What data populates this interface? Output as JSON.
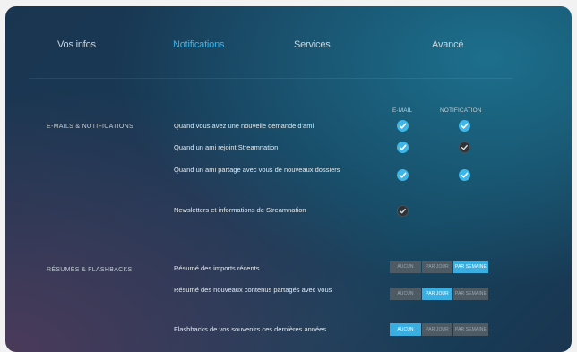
{
  "tabs": [
    {
      "label": "Vos infos",
      "active": false
    },
    {
      "label": "Notifications",
      "active": true
    },
    {
      "label": "Services",
      "active": false
    },
    {
      "label": "Avancé",
      "active": false
    }
  ],
  "emails": {
    "section_title": "E-MAILS & NOTIFICATIONS",
    "columns": [
      "E-MAIL",
      "NOTIFICATION"
    ],
    "rows": [
      {
        "label": "Quand vous avez une nouvelle demande d'ami",
        "email": true,
        "notification": true
      },
      {
        "label": "Quand un ami rejoint Streamnation",
        "email": true,
        "notification": false
      },
      {
        "label": "Quand un ami partage avec vous de nouveaux dossiers",
        "email": true,
        "notification": true
      },
      {
        "label": "Newsletters et informations de Streamnation",
        "email": false,
        "notification": null
      }
    ]
  },
  "summaries": {
    "section_title": "RÉSUMÉS & FLASHBACKS",
    "options": [
      "AUCUN",
      "PAR JOUR",
      "PAR SEMAINE"
    ],
    "rows": [
      {
        "label": "Résumé des imports récents",
        "selected": "PAR SEMAINE"
      },
      {
        "label": "Résumé des nouveaux contenus partagés avec vous",
        "selected": "PAR JOUR"
      },
      {
        "label": "Flashbacks de vos souvenirs ces dernières années",
        "selected": "AUCUN"
      }
    ]
  },
  "colors": {
    "accent": "#3eb7e8",
    "active_tab": "#39b6ea",
    "segment_off": "#4e5a64"
  }
}
